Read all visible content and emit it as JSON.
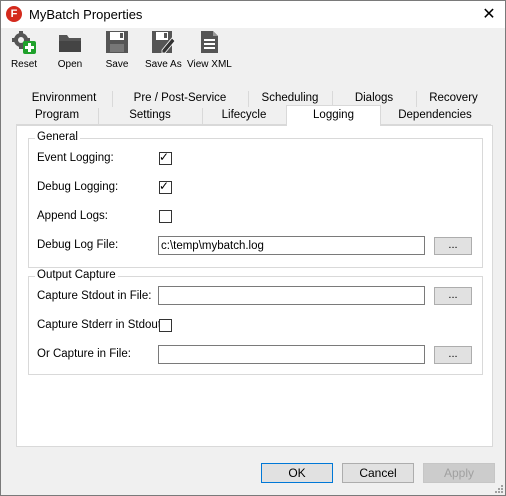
{
  "window": {
    "title": "MyBatch Properties",
    "close_glyph": "✕"
  },
  "toolbar": {
    "reset": "Reset",
    "open": "Open",
    "save": "Save",
    "save_as": "Save As",
    "view_xml": "View XML"
  },
  "tabs": {
    "row1": [
      "Environment",
      "Pre / Post-Service",
      "Scheduling",
      "Dialogs",
      "Recovery"
    ],
    "row2": [
      "Program",
      "Settings",
      "Lifecycle",
      "Logging",
      "Dependencies"
    ],
    "active": "Logging"
  },
  "general": {
    "title": "General",
    "event_logging_label": "Event Logging:",
    "event_logging_checked": true,
    "debug_logging_label": "Debug Logging:",
    "debug_logging_checked": true,
    "append_logs_label": "Append Logs:",
    "append_logs_checked": false,
    "debug_log_file_label": "Debug Log File:",
    "debug_log_file_value": "c:\\temp\\mybatch.log",
    "browse": "..."
  },
  "output_capture": {
    "title": "Output Capture",
    "stdout_label": "Capture Stdout in File:",
    "stdout_value": "",
    "stderr_label": "Capture Stderr in Stdout:",
    "stderr_checked": false,
    "or_capture_label": "Or Capture in File:",
    "or_capture_value": "",
    "browse": "..."
  },
  "buttons": {
    "ok": "OK",
    "cancel": "Cancel",
    "apply": "Apply"
  }
}
